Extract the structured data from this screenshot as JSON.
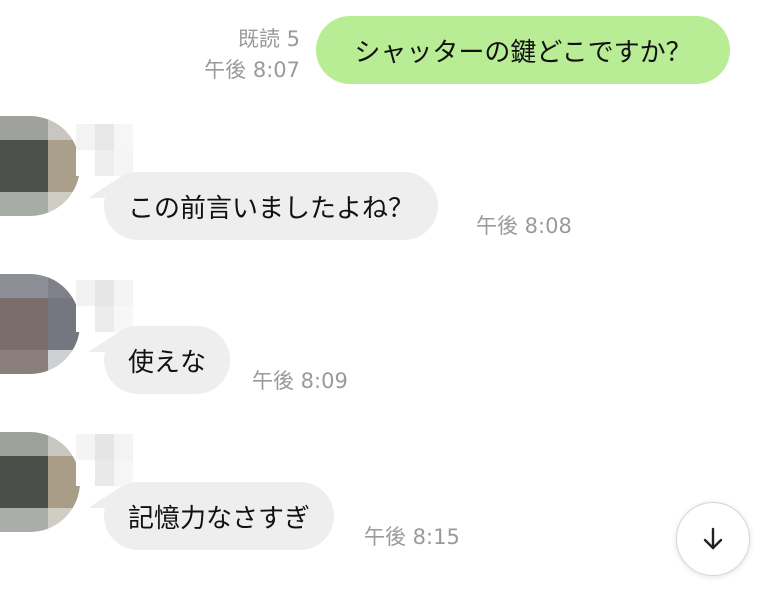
{
  "outgoing": {
    "text": "シャッターの鍵どこですか？",
    "read_status": "既読 5",
    "time": "午後 8:07"
  },
  "incoming": [
    {
      "text": "この前言いましたよね？",
      "time": "午後 8:08"
    },
    {
      "text": "使えな",
      "time": "午後 8:09"
    },
    {
      "text": "記憶力なさすぎ",
      "time": "午後 8:15"
    }
  ],
  "colors": {
    "outgoing_bubble": "#b8ec95",
    "incoming_bubble": "#eeeeee",
    "meta_text": "#9a9a9a"
  },
  "icons": {
    "scroll_button": "arrow-down-icon"
  }
}
